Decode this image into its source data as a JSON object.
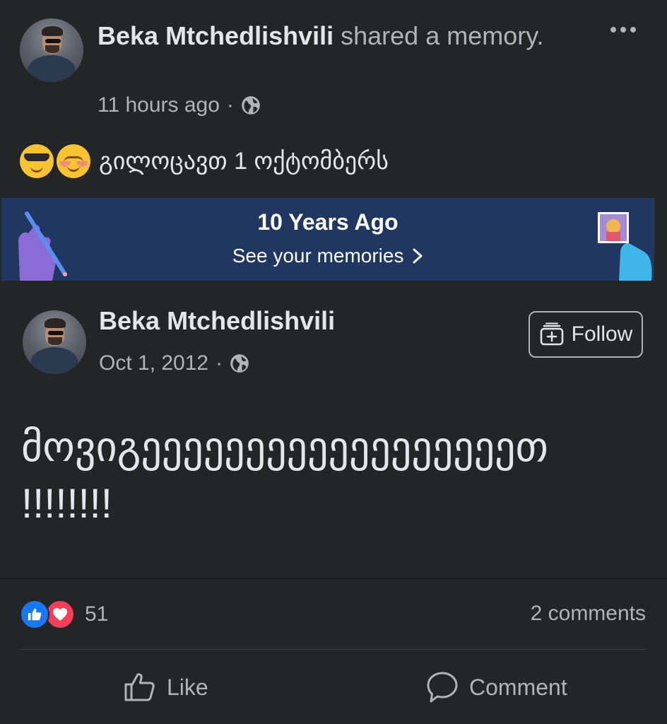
{
  "share_header": {
    "author": "Beka Mtchedlishvili",
    "action_text": " shared a memory.",
    "time": "11 hours ago",
    "separator": "·"
  },
  "caption": {
    "emojis": [
      "smiling-face-with-sunglasses",
      "smiling-face-blushing"
    ],
    "text": "გილოცავთ 1 ოქტომბერს"
  },
  "memories_banner": {
    "title": "10 Years Ago",
    "link": "See your memories",
    "background": "#203761"
  },
  "original_post": {
    "author": "Beka Mtchedlishvili",
    "date": "Oct 1, 2012",
    "separator": "·",
    "follow_label": "Follow",
    "body": "მოვიგეეეეეეეეეეეეეეეეეეთ !!!!!!!!"
  },
  "footer": {
    "reaction_count": "51",
    "comments": "2 comments",
    "like_label": "Like",
    "comment_label": "Comment"
  },
  "colors": {
    "background": "#242526",
    "text_primary": "#e4e6eb",
    "text_secondary": "#b0b3b8",
    "like_blue": "#1877f2",
    "love_red": "#f33e58"
  }
}
